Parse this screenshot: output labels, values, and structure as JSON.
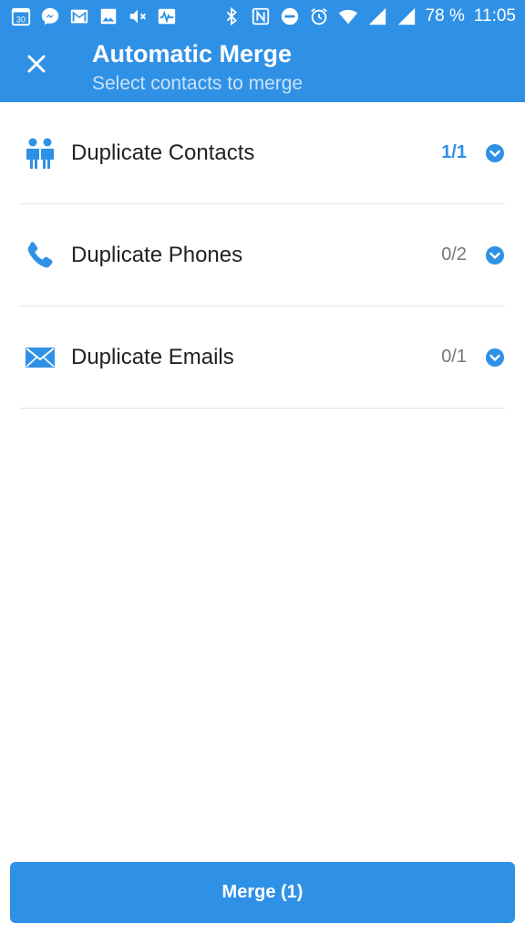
{
  "status_bar": {
    "left_icons": [
      "calendar-icon",
      "messenger-icon",
      "gmail-icon",
      "gallery-icon",
      "mute-icon",
      "activity-icon"
    ],
    "calendar_day": "30",
    "right_icons": [
      "bluetooth-icon",
      "nfc-icon",
      "dnd-icon",
      "alarm-icon",
      "wifi-icon",
      "signal-icon",
      "signal-icon-2"
    ],
    "battery": "78 %",
    "time": "11:05"
  },
  "app_bar": {
    "close_icon": "close-icon",
    "title": "Automatic Merge",
    "subtitle": "Select contacts to merge"
  },
  "list": {
    "items": [
      {
        "icon": "people-icon",
        "label": "Duplicate Contacts",
        "count": "1/1",
        "active": true
      },
      {
        "icon": "phone-icon",
        "label": "Duplicate Phones",
        "count": "0/2",
        "active": false
      },
      {
        "icon": "email-icon",
        "label": "Duplicate Emails",
        "count": "0/1",
        "active": false
      }
    ]
  },
  "merge_button": {
    "label": "Merge (1)"
  },
  "colors": {
    "primary": "#2f91e6",
    "subtitle": "#c9e2f8",
    "divider": "#e4e4e4",
    "count_inactive": "#777777"
  }
}
